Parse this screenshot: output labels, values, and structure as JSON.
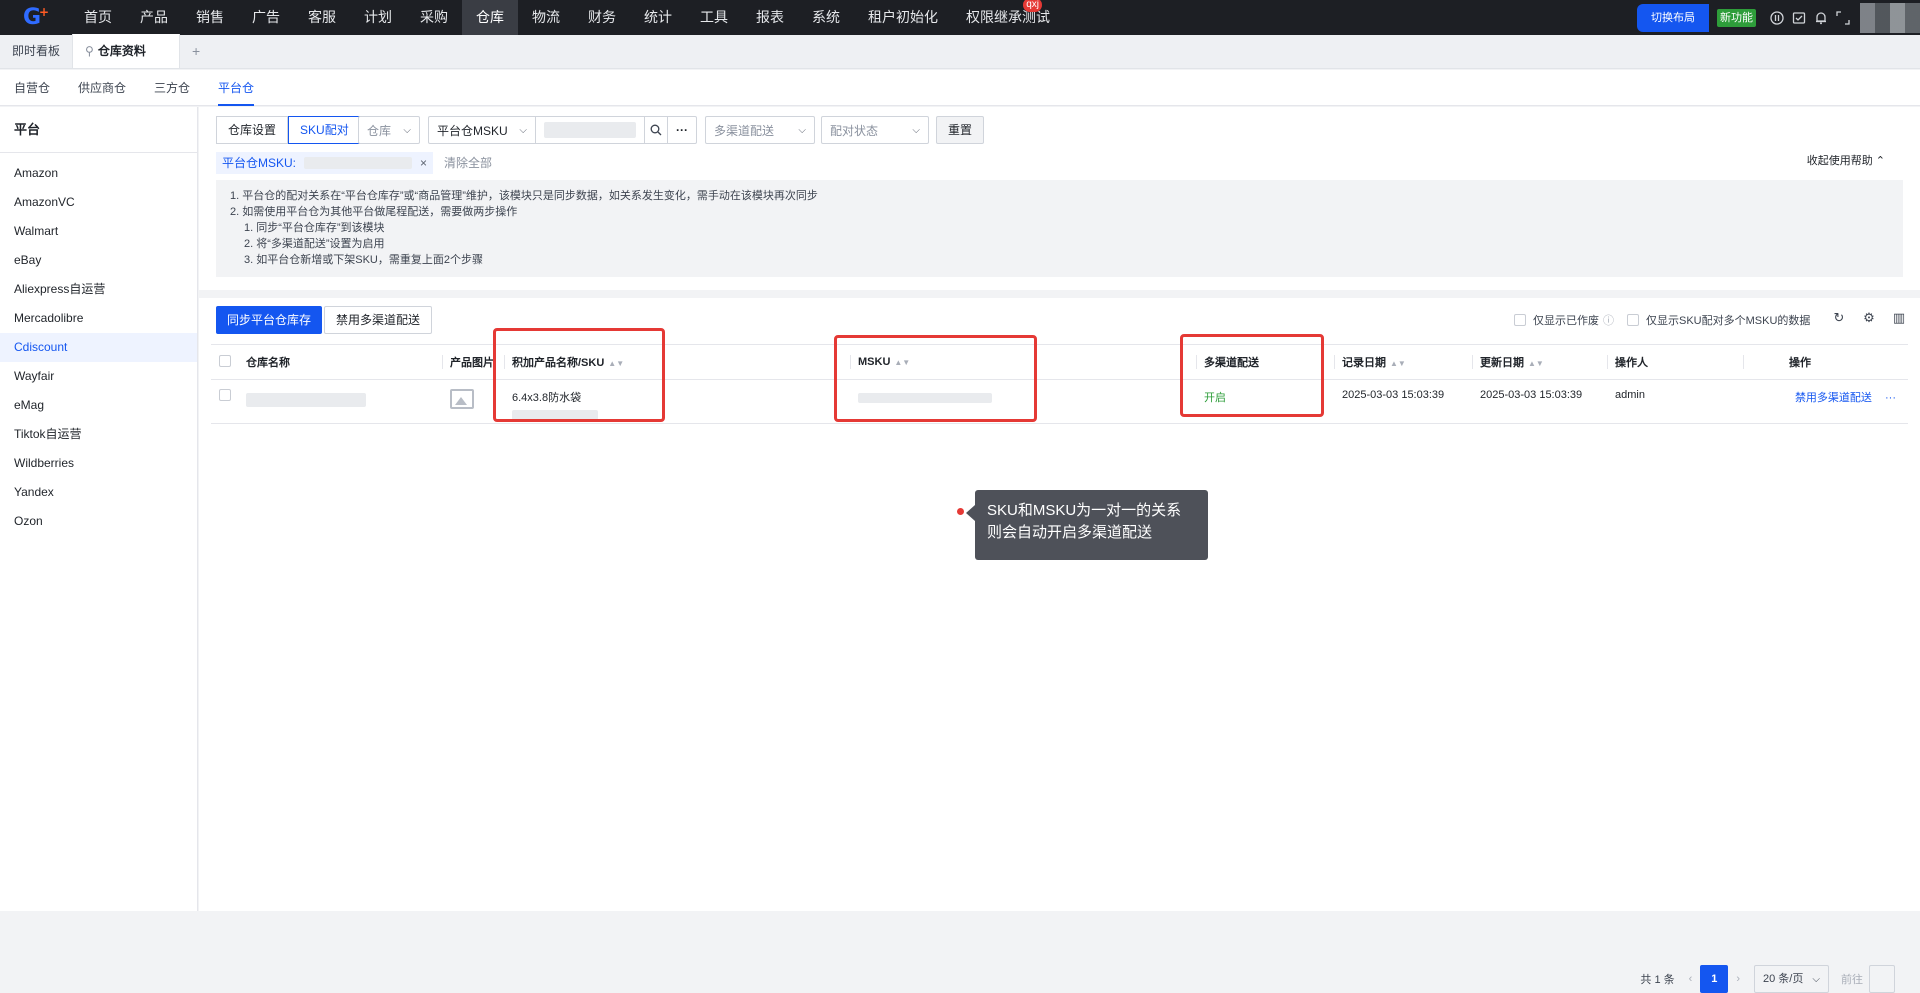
{
  "topnav": {
    "logo_text": "G",
    "items": [
      "首页",
      "产品",
      "销售",
      "广告",
      "客服",
      "计划",
      "采购",
      "仓库",
      "物流",
      "财务",
      "统计",
      "工具",
      "报表",
      "系统",
      "租户初始化",
      "权限继承测试"
    ],
    "active_index": 7,
    "badge": "qxj",
    "switch_layout": "切换布局",
    "new_feature": "新功能"
  },
  "pagetabs": {
    "items": [
      "即时看板",
      "仓库资料"
    ],
    "active_index": 1,
    "add": "+"
  },
  "subtabs": {
    "items": [
      "自营仓",
      "供应商仓",
      "三方仓",
      "平台仓"
    ],
    "active_index": 3
  },
  "sidebar": {
    "title": "平台",
    "items": [
      "Amazon",
      "AmazonVC",
      "Walmart",
      "eBay",
      "Aliexpress自运营",
      "Mercadolibre",
      "Cdiscount",
      "Wayfair",
      "eMag",
      "Tiktok自运营",
      "Wildberries",
      "Yandex",
      "Ozon"
    ],
    "active_index": 6
  },
  "filters": {
    "seg_warehouse_settings": "仓库设置",
    "seg_sku_match": "SKU配对",
    "warehouse_placeholder": "仓库",
    "msku_select": "平台仓MSKU",
    "more": "···",
    "multichannel_placeholder": "多渠道配送",
    "match_status_placeholder": "配对状态",
    "reset": "重置",
    "chip_label": "平台仓MSKU:",
    "chip_close": "×",
    "clear_all": "清除全部",
    "collapse_help": "收起使用帮助"
  },
  "help": {
    "lines": [
      "1. 平台仓的配对关系在“平台仓库存”或“商品管理”维护，该模块只是同步数据，如关系发生变化，需手动在该模块再次同步",
      "2. 如需使用平台仓为其他平台做尾程配送，需要做两步操作",
      "1. 同步“平台仓库存”到该模块",
      "2. 将“多渠道配送”设置为启用",
      "3. 如平台仓新增或下架SKU，需重复上面2个步骤"
    ]
  },
  "actions": {
    "sync": "同步平台仓库存",
    "disable_multichannel": "禁用多渠道配送",
    "only_show_ready": "仅显示已作废",
    "only_show_multi": "仅显示SKU配对多个MSKU的数据"
  },
  "table": {
    "headers": [
      "仓库名称",
      "产品图片",
      "积加产品名称/SKU",
      "MSKU",
      "多渠道配送",
      "记录日期",
      "更新日期",
      "操作人",
      "操作"
    ],
    "rows": [
      {
        "product_name": "6.4x3.8防水袋",
        "multichannel": "开启",
        "record_date": "2025-03-03 15:03:39",
        "update_date": "2025-03-03 15:03:39",
        "operator": "admin",
        "action": "禁用多渠道配送",
        "more": "···"
      }
    ]
  },
  "tooltip": {
    "line1": "SKU和MSKU为一对一的关系",
    "line2": "则会自动开启多渠道配送"
  },
  "pager": {
    "total": "共 1 条",
    "prev": "‹",
    "current": "1",
    "next": "›",
    "size": "20 条/页",
    "jump": "前往"
  },
  "colors": {
    "accent": "#1456f0",
    "topnav_bg": "#1d1f24",
    "annotation_red": "#e53935",
    "success_green": "#2e9d3a"
  }
}
